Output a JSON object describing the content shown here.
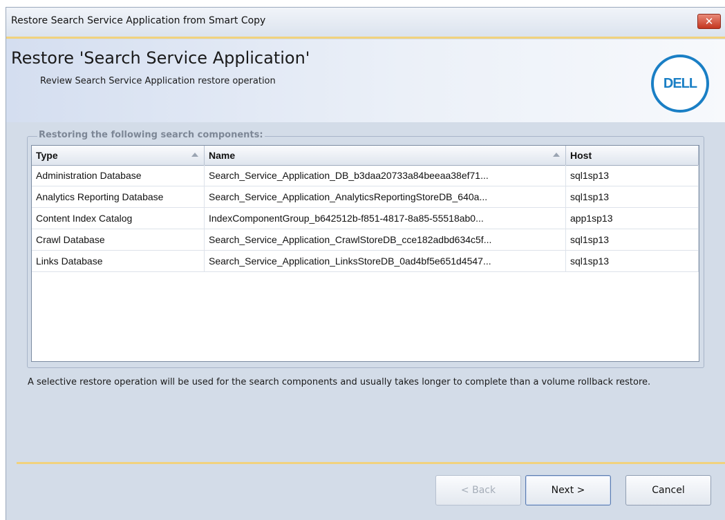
{
  "window": {
    "title": "Restore Search Service Application from Smart Copy",
    "close_label": "✕"
  },
  "header": {
    "title": "Restore 'Search Service Application'",
    "subtitle": "Review Search Service Application restore operation",
    "logo_text": "DELL",
    "logo_color": "#1a7fc5"
  },
  "group": {
    "label": "Restoring the following search components:"
  },
  "table": {
    "columns": [
      "Type",
      "Name",
      "Host"
    ],
    "rows": [
      {
        "type": "Administration Database",
        "name": "Search_Service_Application_DB_b3daa20733a84beeaa38ef71...",
        "host": "sql1sp13"
      },
      {
        "type": "Analytics Reporting Database",
        "name": "Search_Service_Application_AnalyticsReportingStoreDB_640a...",
        "host": "sql1sp13"
      },
      {
        "type": "Content Index Catalog",
        "name": "IndexComponentGroup_b642512b-f851-4817-8a85-55518ab0...",
        "host": "app1sp13"
      },
      {
        "type": "Crawl Database",
        "name": "Search_Service_Application_CrawlStoreDB_cce182adbd634c5f...",
        "host": "sql1sp13"
      },
      {
        "type": "Links Database",
        "name": "Search_Service_Application_LinksStoreDB_0ad4bf5e651d4547...",
        "host": "sql1sp13"
      }
    ]
  },
  "note": "A selective restore operation will be used for the search components and usually takes longer to complete than a volume rollback restore.",
  "buttons": {
    "back": "< Back",
    "next": "Next >",
    "cancel": "Cancel"
  }
}
